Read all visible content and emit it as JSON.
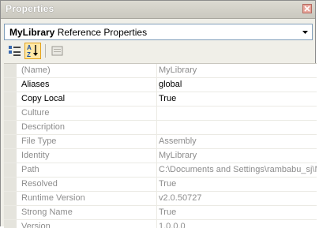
{
  "window": {
    "title": "Properties"
  },
  "combo": {
    "object_name": "MyLibrary",
    "object_type": "Reference Properties"
  },
  "toolbar": {
    "categorized_icon": "categorized-icon",
    "alphabetical_icon": "alphabetical-icon",
    "property_pages_icon": "property-pages-icon"
  },
  "properties": [
    {
      "name": "(Name)",
      "value": "MyLibrary",
      "readonly": true
    },
    {
      "name": "Aliases",
      "value": "global",
      "readonly": false
    },
    {
      "name": "Copy Local",
      "value": "True",
      "readonly": false
    },
    {
      "name": "Culture",
      "value": "",
      "readonly": true
    },
    {
      "name": "Description",
      "value": "",
      "readonly": true
    },
    {
      "name": "File Type",
      "value": "Assembly",
      "readonly": true
    },
    {
      "name": "Identity",
      "value": "MyLibrary",
      "readonly": true
    },
    {
      "name": "Path",
      "value": "C:\\Documents and Settings\\rambabu_sj\\M",
      "readonly": true
    },
    {
      "name": "Resolved",
      "value": "True",
      "readonly": true
    },
    {
      "name": "Runtime Version",
      "value": "v2.0.50727",
      "readonly": true
    },
    {
      "name": "Strong Name",
      "value": "True",
      "readonly": true
    },
    {
      "name": "Version",
      "value": "1.0.0.0",
      "readonly": true
    }
  ]
}
